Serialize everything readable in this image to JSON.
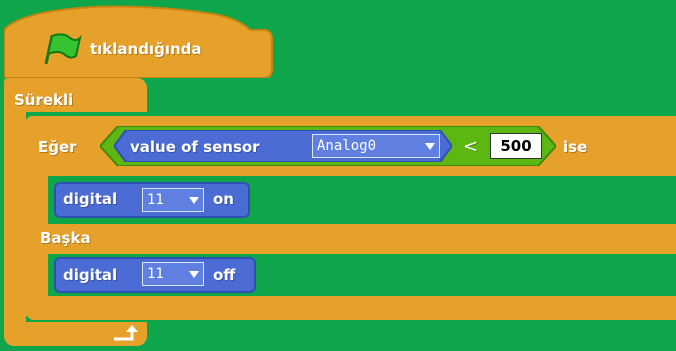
{
  "hat": {
    "label": "tıklandığında",
    "icon": "green-flag-icon"
  },
  "forever": {
    "label": "Sürekli",
    "icon": "loop-arrow-icon"
  },
  "ifelse": {
    "if_label": "Eğer",
    "then_label": "ise",
    "else_label": "Başka"
  },
  "condition": {
    "operator": "<",
    "value": "500",
    "sensor_block": {
      "label": "value of sensor",
      "selected": "Analog0"
    }
  },
  "then_block": {
    "label": "digital",
    "pin": "11",
    "state": "on"
  },
  "else_block": {
    "label": "digital",
    "pin": "11",
    "state": "off"
  },
  "colors": {
    "background": "#0fa54a",
    "control": "#e6a12b",
    "motion": "#4a6cd4",
    "operators": "#5cb712"
  }
}
